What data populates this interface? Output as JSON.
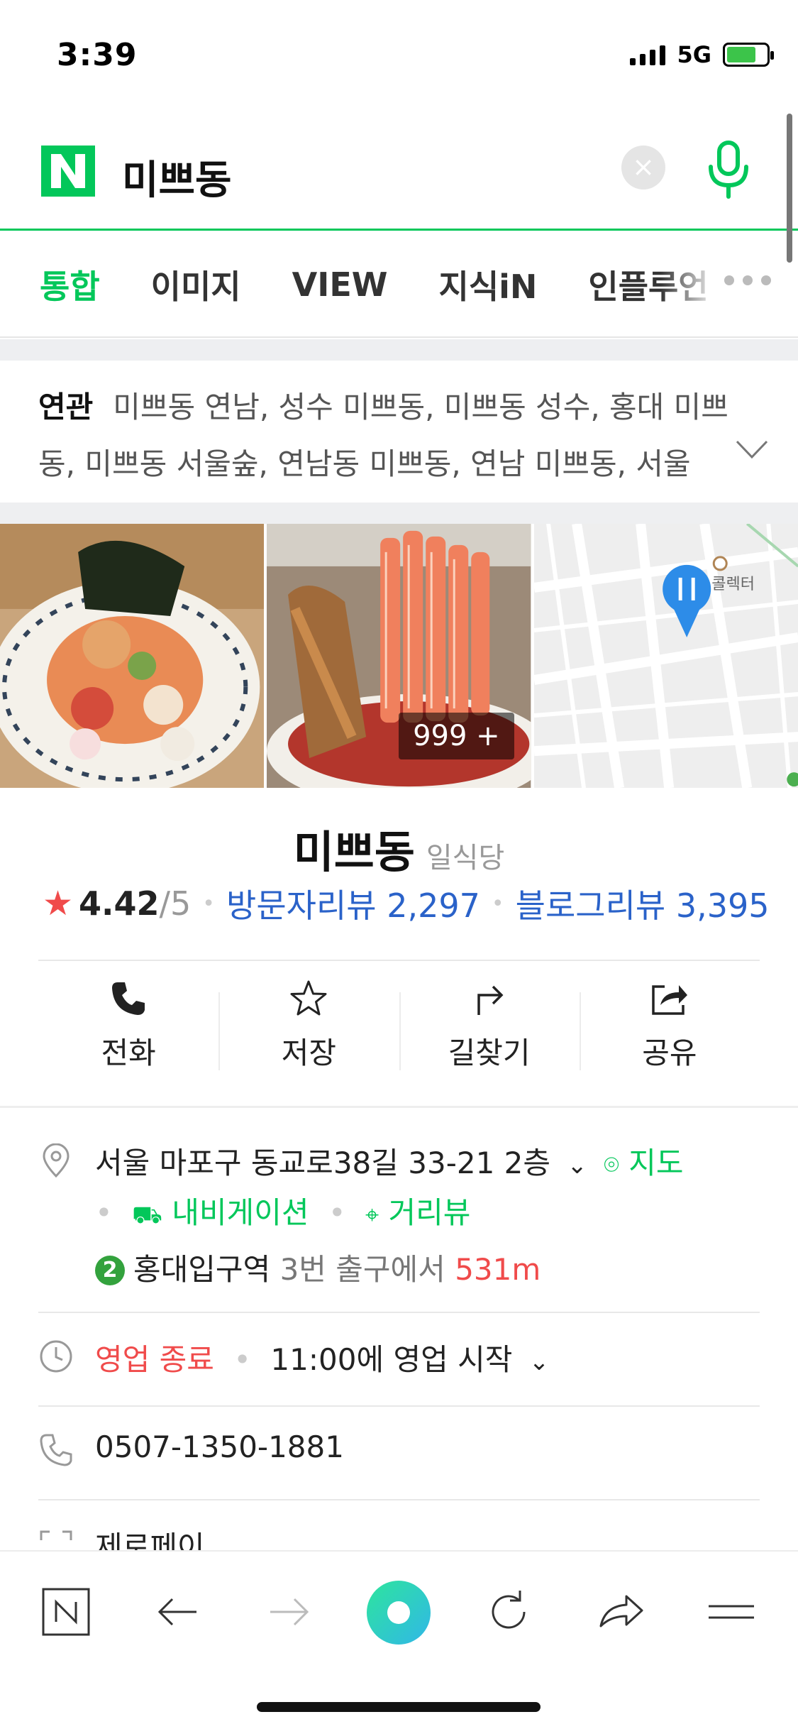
{
  "status": {
    "time": "3:39",
    "network": "5G"
  },
  "search": {
    "query": "미쁘동"
  },
  "tabs": [
    {
      "label": "통합",
      "active": true
    },
    {
      "label": "이미지"
    },
    {
      "label": "VIEW"
    },
    {
      "label": "지식iN"
    },
    {
      "label": "인플루언"
    }
  ],
  "related": {
    "label": "연관",
    "text": "미쁘동 연남, 성수 미쁘동, 미쁘동 성수, 홍대 미쁘동, 미쁘동 서울숲, 연남동 미쁘동, 연남 미쁘동, 서울"
  },
  "photos": {
    "count_label": "999 +",
    "map_label": "콜렉터"
  },
  "place": {
    "name": "미쁘동",
    "category": "일식당",
    "rating": "4.42",
    "rating_max": "/5",
    "visitor_reviews": "방문자리뷰 2,297",
    "blog_reviews": "블로그리뷰 3,395"
  },
  "actions": [
    {
      "label": "전화",
      "icon": "phone-icon"
    },
    {
      "label": "저장",
      "icon": "star-icon"
    },
    {
      "label": "길찾기",
      "icon": "directions-icon"
    },
    {
      "label": "공유",
      "icon": "share-icon"
    }
  ],
  "info": {
    "address": "서울 마포구 동교로38길 33-21 2층",
    "map_link": "지도",
    "navigation_link": "내비게이션",
    "streetview_link": "거리뷰",
    "subway_line": "2",
    "station": "홍대입구역",
    "exit_text": "3번 출구에서",
    "distance": "531m",
    "hours_status": "영업 종료",
    "hours_next": "11:00에 영업 시작",
    "phone": "0507-1350-1881",
    "payment": "제로페이"
  },
  "colors": {
    "naver_green": "#03c75a",
    "link_blue": "#2a62c9",
    "alert_red": "#f04b4b"
  }
}
